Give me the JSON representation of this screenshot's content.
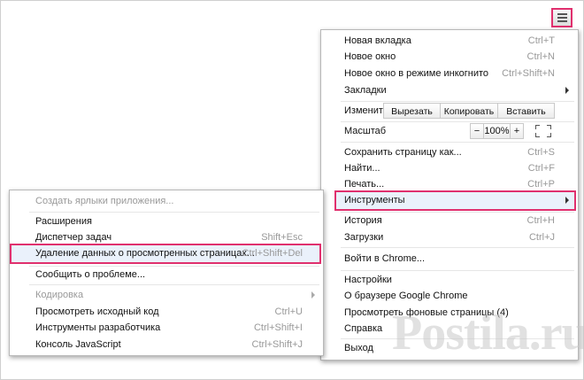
{
  "menu_button": {
    "icon": "hamburger-menu-icon"
  },
  "main_menu": {
    "new_tab": {
      "label": "Новая вкладка",
      "shortcut": "Ctrl+T"
    },
    "new_window": {
      "label": "Новое окно",
      "shortcut": "Ctrl+N"
    },
    "incognito": {
      "label": "Новое окно в режиме инкогнито",
      "shortcut": "Ctrl+Shift+N"
    },
    "bookmarks": {
      "label": "Закладки"
    },
    "edit": {
      "label": "Изменить",
      "cut": "Вырезать",
      "copy": "Копировать",
      "paste": "Вставить"
    },
    "zoom": {
      "label": "Масштаб",
      "minus": "−",
      "value": "100%",
      "plus": "+",
      "fullscreen_icon": "fullscreen-icon"
    },
    "save_page": {
      "label": "Сохранить страницу как...",
      "shortcut": "Ctrl+S"
    },
    "find": {
      "label": "Найти...",
      "shortcut": "Ctrl+F"
    },
    "print": {
      "label": "Печать...",
      "shortcut": "Ctrl+P"
    },
    "tools": {
      "label": "Инструменты"
    },
    "history": {
      "label": "История",
      "shortcut": "Ctrl+H"
    },
    "downloads": {
      "label": "Загрузки",
      "shortcut": "Ctrl+J"
    },
    "signin": {
      "label": "Войти в Chrome..."
    },
    "settings": {
      "label": "Настройки"
    },
    "about": {
      "label": "О браузере Google Chrome"
    },
    "background_pages": {
      "label": "Просмотреть фоновые страницы (4)"
    },
    "help": {
      "label": "Справка"
    },
    "exit": {
      "label": "Выход"
    }
  },
  "tools_submenu": {
    "create_shortcuts": {
      "label": "Создать ярлыки приложения..."
    },
    "extensions": {
      "label": "Расширения"
    },
    "task_manager": {
      "label": "Диспетчер задач",
      "shortcut": "Shift+Esc"
    },
    "clear_data": {
      "label": "Удаление данных о просмотренных страницах...",
      "shortcut": "Ctrl+Shift+Del"
    },
    "report_issue": {
      "label": "Сообщить о проблеме..."
    },
    "encoding": {
      "label": "Кодировка"
    },
    "view_source": {
      "label": "Просмотреть исходный код",
      "shortcut": "Ctrl+U"
    },
    "dev_tools": {
      "label": "Инструменты разработчика",
      "shortcut": "Ctrl+Shift+I"
    },
    "js_console": {
      "label": "Консоль JavaScript",
      "shortcut": "Ctrl+Shift+J"
    }
  },
  "watermark": {
    "text": "Postila.ru"
  },
  "colors": {
    "highlight_border": "#e0306e",
    "disabled_text": "#999999"
  }
}
